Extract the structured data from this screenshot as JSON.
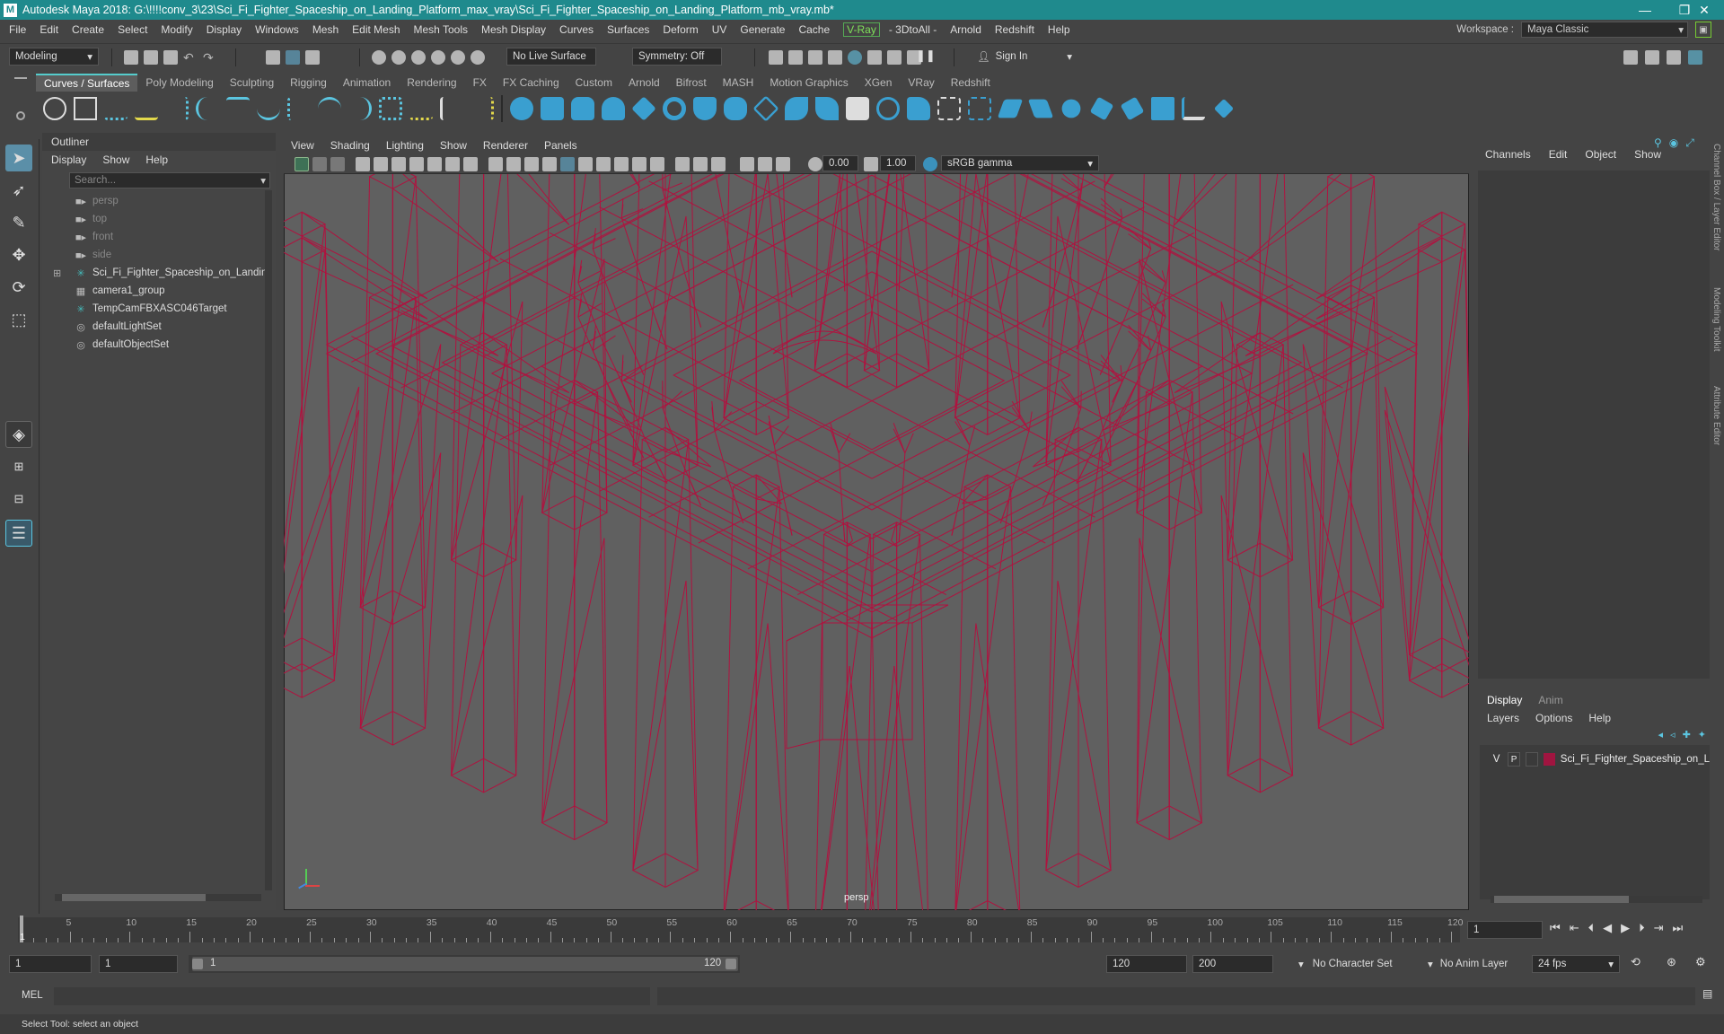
{
  "window": {
    "title": "Autodesk Maya 2018: G:\\!!!!conv_3\\23\\Sci_Fi_Fighter_Spaceship_on_Landing_Platform_max_vray\\Sci_Fi_Fighter_Spaceship_on_Landing_Platform_mb_vray.mb*",
    "app_icon": "M",
    "controls": [
      "—",
      "❐",
      "✕"
    ]
  },
  "menubar": {
    "items": [
      "File",
      "Edit",
      "Create",
      "Select",
      "Modify",
      "Display",
      "Windows",
      "Mesh",
      "Edit Mesh",
      "Mesh Tools",
      "Mesh Display",
      "Curves",
      "Surfaces",
      "Deform",
      "UV",
      "Generate",
      "Cache"
    ],
    "vray": "V-Ray",
    "items2": [
      "- 3DtoAll -",
      "Arnold",
      "Redshift",
      "Help"
    ]
  },
  "workspace": {
    "label": "Workspace :",
    "value": "Maya Classic"
  },
  "statusline": {
    "mode": "Modeling",
    "live_surface": "No Live Surface",
    "symmetry": "Symmetry: Off",
    "sign_in": "Sign In"
  },
  "shelf": {
    "tabs": [
      "Curves / Surfaces",
      "Poly Modeling",
      "Sculpting",
      "Rigging",
      "Animation",
      "Rendering",
      "FX",
      "FX Caching",
      "Custom",
      "Arnold",
      "Bifrost",
      "MASH",
      "Motion Graphics",
      "XGen",
      "VRay",
      "Redshift"
    ],
    "active": "Curves / Surfaces"
  },
  "outliner": {
    "title": "Outliner",
    "menu": [
      "Display",
      "Show",
      "Help"
    ],
    "search_placeholder": "Search...",
    "items": [
      {
        "label": "persp",
        "icon": "camera-icon",
        "dim": true
      },
      {
        "label": "top",
        "icon": "camera-icon",
        "dim": true
      },
      {
        "label": "front",
        "icon": "camera-icon",
        "dim": true
      },
      {
        "label": "side",
        "icon": "camera-icon",
        "dim": true
      },
      {
        "label": "Sci_Fi_Fighter_Spaceship_on_Landing",
        "icon": "transform-icon",
        "dim": false,
        "expandable": true
      },
      {
        "label": "camera1_group",
        "icon": "group-icon",
        "dim": false
      },
      {
        "label": "TempCamFBXASC046Target",
        "icon": "transform-icon",
        "dim": false
      },
      {
        "label": "defaultLightSet",
        "icon": "set-icon",
        "dim": false
      },
      {
        "label": "defaultObjectSet",
        "icon": "set-icon",
        "dim": false
      }
    ]
  },
  "viewport": {
    "menu": [
      "View",
      "Shading",
      "Lighting",
      "Show",
      "Renderer",
      "Panels"
    ],
    "exposure": "0.00",
    "gamma": "1.00",
    "color_space": "sRGB gamma",
    "camera_label": "persp",
    "wire_color": "#b0123f"
  },
  "channelbox": {
    "menu": [
      "Channels",
      "Edit",
      "Object",
      "Show"
    ]
  },
  "side_tabs": [
    "Channel Box / Layer Editor",
    "Modeling Toolkit",
    "Attribute Editor"
  ],
  "layers": {
    "tabs": [
      "Display",
      "Anim"
    ],
    "active_tab": "Display",
    "menu": [
      "Layers",
      "Options",
      "Help"
    ],
    "layer": {
      "v": "V",
      "p": "P",
      "name": "Sci_Fi_Fighter_Spaceship_on_L",
      "color": "#a01540"
    }
  },
  "timeline": {
    "labels": [
      "5",
      "10",
      "15",
      "20",
      "25",
      "30",
      "35",
      "40",
      "45",
      "50",
      "55",
      "60",
      "65",
      "70",
      "75",
      "80",
      "85",
      "90",
      "95",
      "100",
      "105",
      "110",
      "115",
      "120"
    ],
    "current_frame_marker": "1",
    "current_frame": "1"
  },
  "range": {
    "start": "1",
    "playback_start": "1",
    "range_start": "1",
    "range_end": "120",
    "playback_end": "120",
    "end": "200",
    "character_set": "No Character Set",
    "anim_layer": "No Anim Layer",
    "fps": "24 fps"
  },
  "cmdline": {
    "label": "MEL"
  },
  "helpline": {
    "text": "Select Tool: select an object"
  }
}
